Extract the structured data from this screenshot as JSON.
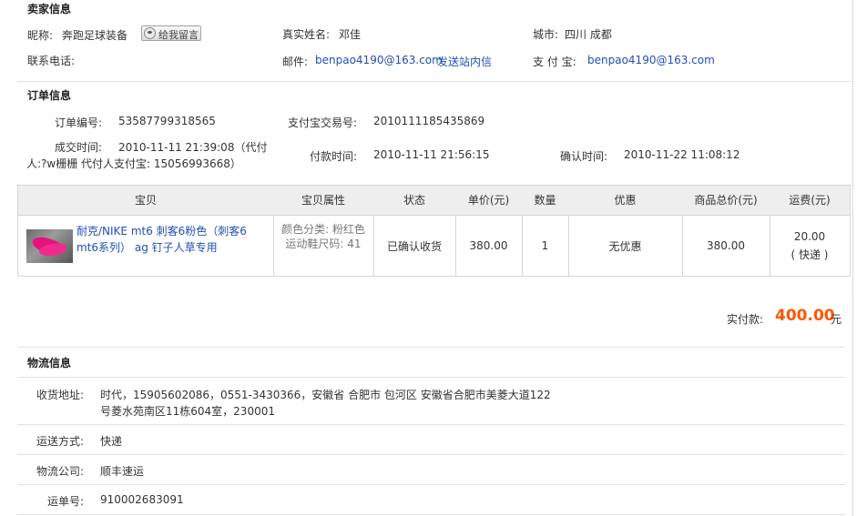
{
  "seller": {
    "title": "卖家信息",
    "nick_label": "昵称:",
    "nick_value": "奔跑足球装备",
    "message_button": "给我留言",
    "realname_label": "真实姓名:",
    "realname_value": "邓佳",
    "city_label": "城市:",
    "city_value": "四川 成都",
    "phone_label": "联系电话:",
    "email_label": "邮件:",
    "email_value": "benpao4190@163.com",
    "send_msg_link": "发送站内信",
    "alipay_label": "支 付 宝:",
    "alipay_value": "benpao4190@163.com"
  },
  "order": {
    "title": "订单信息",
    "order_no_label": "订单编号:",
    "order_no_value": "53587799318565",
    "alipay_trade_label": "支付宝交易号:",
    "alipay_trade_value": "2010111185435869",
    "deal_time_label": "成交时间:",
    "deal_time_line1": "2010-11-11 21:39:08（代付",
    "deal_time_line2": "人:?w栅栅 代付人支付宝: 15056993668）",
    "pay_time_label": "付款时间:",
    "pay_time_value": "2010-11-11 21:56:15",
    "confirm_time_label": "确认时间:",
    "confirm_time_value": "2010-11-22 11:08:12"
  },
  "table": {
    "headers": [
      "宝贝",
      "宝贝属性",
      "状态",
      "单价(元)",
      "数量",
      "优惠",
      "商品总价(元)",
      "运费(元)"
    ],
    "item": {
      "name": "耐克/NIKE mt6 刺客6粉色（刺客6 mt6系列） ag 钉子人草专用",
      "attr_color": "颜色分类: 粉红色",
      "attr_size": "运动鞋尺码: 41",
      "status": "已确认收货",
      "unit_price": "380.00",
      "quantity": "1",
      "discount": "无优惠",
      "total": "380.00",
      "shipping_fee": "20.00",
      "shipping_type": "( 快递 )"
    }
  },
  "payment": {
    "label": "实付款:",
    "amount": "400.00",
    "unit": "元",
    "amount_color": "#ff5500"
  },
  "logistics": {
    "title": "物流信息",
    "address_label": "收货地址:",
    "address_line1": "时代，15905602086，0551-3430366，安徽省 合肥市 包河区 安徽省合肥市美菱大道122",
    "address_line2": "号菱水苑南区11栋604室，230001",
    "method_label": "运送方式:",
    "method_value": "快递",
    "company_label": "物流公司:",
    "company_value": "顺丰速运",
    "waybill_label": "运单号:",
    "waybill_value": "910002683091"
  }
}
